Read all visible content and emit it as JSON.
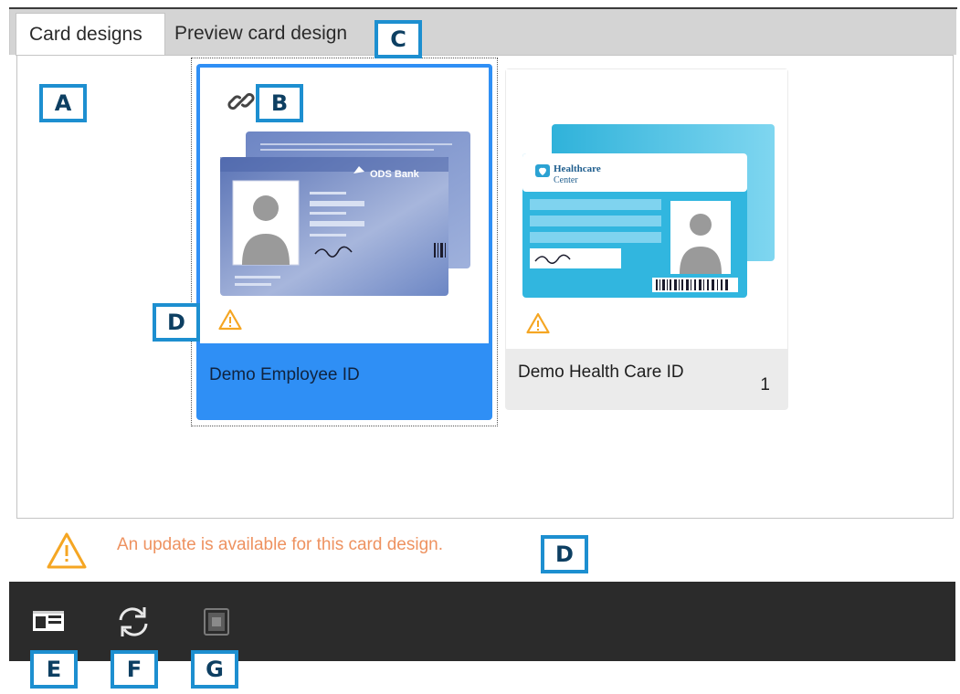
{
  "tabs": [
    {
      "label": "Card designs",
      "active": true
    },
    {
      "label": "Preview card design",
      "active": false
    }
  ],
  "cards": [
    {
      "name": "Demo Employee ID",
      "selected": true,
      "linked": true,
      "warning": true,
      "thumbnail": {
        "brand": "ODS Bank",
        "color": "#5a77b8"
      }
    },
    {
      "name": "Demo Health Care ID",
      "selected": false,
      "linked": false,
      "warning": true,
      "count": "1",
      "thumbnail": {
        "brand": "Healthcare Center",
        "color": "#35b9dd"
      }
    }
  ],
  "notice": {
    "text": "An update is available for this card design.",
    "icon": "warning-icon",
    "color": "#ee9260"
  },
  "toolbar": {
    "buttons": [
      {
        "icon": "card-layout-icon",
        "enabled": true
      },
      {
        "icon": "refresh-icon",
        "enabled": true
      },
      {
        "icon": "card-chip-icon",
        "enabled": false
      }
    ]
  },
  "callouts": [
    "A",
    "B",
    "C",
    "D",
    "D",
    "D",
    "E",
    "F",
    "G"
  ],
  "colors": {
    "selection": "#2f8ff5",
    "callout_border": "#1d8fd0",
    "toolbar": "#2b2b2b",
    "warning": "#f5a623"
  }
}
